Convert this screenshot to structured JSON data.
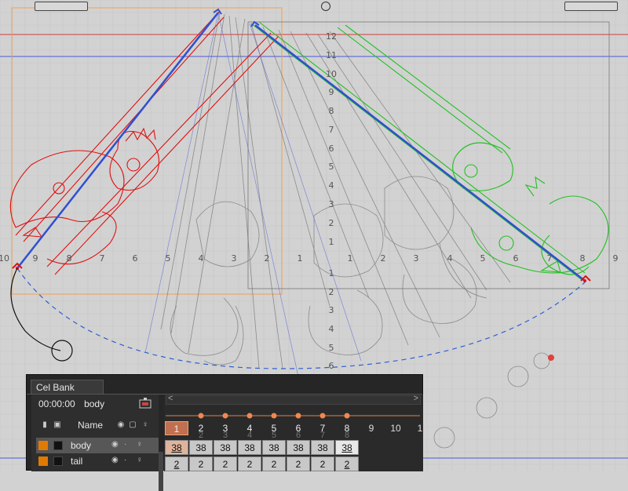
{
  "canvas": {
    "colors": {
      "background": "#d2d2d2",
      "grid": "#c4c4c4",
      "red_guide": "#d23a3a",
      "blue_guide": "#4a5ad8",
      "red_stroke": "#e01010",
      "green_stroke": "#22c022",
      "blue_bone": "#3050d0",
      "ghost_stroke": "#555555",
      "camera_frame": "#f0a050",
      "path_dash": "#3060d0"
    },
    "horizontal_axis_labels": [
      "10",
      "9",
      "8",
      "7",
      "6",
      "5",
      "4",
      "3",
      "2",
      "1",
      "1",
      "2",
      "3",
      "4",
      "5",
      "6",
      "7",
      "8",
      "9"
    ],
    "vertical_axis_labels_top": [
      "12",
      "11",
      "10",
      "9",
      "8",
      "7",
      "6",
      "5",
      "4",
      "3",
      "2",
      "1"
    ],
    "vertical_axis_labels_bottom": [
      "1",
      "2",
      "3",
      "4",
      "5",
      "6"
    ]
  },
  "cel_bank": {
    "tab_label": "Cel Bank",
    "timecode": "00:00:00",
    "current_layer": "body",
    "header": {
      "name_label": "Name",
      "icons": [
        "clip-icon",
        "stack-icon",
        "eye-icon",
        "lock-icon",
        "bulb-icon"
      ]
    },
    "layers": [
      {
        "name": "body",
        "color": "#e07a00",
        "selected": true
      },
      {
        "name": "tail",
        "color": "#e07a00",
        "selected": false
      }
    ],
    "timeline": {
      "frame_numbers": [
        "1",
        "2",
        "3",
        "4",
        "5",
        "6",
        "7",
        "8",
        "9",
        "10",
        "1"
      ],
      "ghost_numbers": [
        "2",
        "3",
        "4",
        "5",
        "6",
        "7",
        "8"
      ],
      "body_values": [
        "38",
        "38",
        "38",
        "38",
        "38",
        "38",
        "38",
        "38"
      ],
      "tail_values": [
        "2",
        "2",
        "2",
        "2",
        "2",
        "2",
        "2",
        "2"
      ]
    }
  }
}
